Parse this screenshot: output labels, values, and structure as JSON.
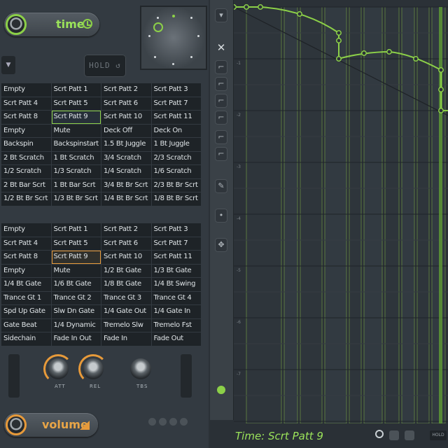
{
  "time_section": {
    "label": "time"
  },
  "volume_section": {
    "label": "volume"
  },
  "hold_button": {
    "label": "HOLD ↺"
  },
  "patterns_top": [
    "Empty",
    "Scrt Patt 1",
    "Scrt Patt 2",
    "Scrt Patt 3",
    "Scrt Patt 4",
    "Scrt Patt 5",
    "Scrt Patt 6",
    "Scrt Patt 7",
    "Scrt Patt 8",
    "Scrt Patt 9",
    "Scrt Patt 10",
    "Scrt Patt 11",
    "Empty",
    "Mute",
    "Deck Off",
    "Deck On",
    "Backspin",
    "Backspinstart",
    "1.5 Bt Juggle",
    "1 Bt Juggle",
    "2 Bt Scratch",
    "1 Bt Scratch",
    "3/4 Scratch",
    "2/3 Scratch",
    "1/2 Scratch",
    "1/3 Scratch",
    "1/4 Scratch",
    "1/6 Scratch",
    "2 Bt Bar Scrt",
    "1 Bt Bar Scrt",
    "3/4 Bt Br Scrt",
    "2/3 Bt Br Scrt",
    "1/2 Bt Br Scrt",
    "1/3 Bt Br Scrt",
    "1/4 Bt Br Scrt",
    "1/8 Bt Br Scrt"
  ],
  "patterns_bottom": [
    "Empty",
    "Scrt Patt 1",
    "Scrt Patt 2",
    "Scrt Patt 3",
    "Scrt Patt 4",
    "Scrt Patt 5",
    "Scrt Patt 6",
    "Scrt Patt 7",
    "Scrt Patt 8",
    "Scrt Patt 9",
    "Scrt Patt 10",
    "Scrt Patt 11",
    "Empty",
    "Mute",
    "1/2 Bt Gate",
    "1/3 Bt Gate",
    "1/4 Bt Gate",
    "1/6 Bt Gate",
    "1/8 Bt Gate",
    "1/4 Bt Swing",
    "Trance Gt 1",
    "Trance Gt 2",
    "Trance Gt 3",
    "Trance Gt 4",
    "Spd Up Gate",
    "Slw Dn Gate",
    "1/4 Gate Out",
    "1/4 Gate In",
    "Gate Beat",
    "1/4 Dynamic",
    "Tremelo Slw",
    "Tremelo Fst",
    "Sidechain",
    "Fade In Out",
    "Fade In",
    "Fade Out"
  ],
  "selected_top_index": 9,
  "selected_bottom_index": 9,
  "knobs": {
    "att": "ATT",
    "rel": "REL",
    "tbs": "TBS"
  },
  "editor": {
    "status": "Time: Scrt Patt 9",
    "hold_small": "HOLD",
    "tools": [
      "chevron-down-icon",
      "close-icon",
      "step-icon",
      "step-icon",
      "step-icon",
      "step-icon",
      "step-icon",
      "step-icon",
      "draw-icon",
      "node-icon",
      "move-icon",
      "clock-icon"
    ]
  },
  "colors": {
    "accent_green": "#8cd048",
    "accent_orange": "#e79a3a",
    "panel": "#333a41"
  }
}
